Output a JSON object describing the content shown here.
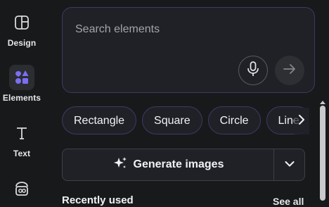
{
  "rail": {
    "items": [
      {
        "label": "Design",
        "icon": "layout-icon"
      },
      {
        "label": "Elements",
        "icon": "shapes-icon",
        "active": true
      },
      {
        "label": "Text",
        "icon": "text-icon"
      },
      {
        "label": "",
        "icon": "brand-icon"
      }
    ]
  },
  "search": {
    "placeholder": "Search elements",
    "mic_icon": "microphone-icon",
    "send_icon": "arrow-right-icon"
  },
  "chips": [
    "Rectangle",
    "Square",
    "Circle",
    "Line"
  ],
  "generate": {
    "label": "Generate images",
    "icon": "sparkle-icon"
  },
  "recent": {
    "title": "Recently used",
    "see_all": "See all"
  },
  "colors": {
    "background": "#18191b",
    "accent_border": "#3d3a63",
    "elements_icon": "#7b6ff2"
  }
}
